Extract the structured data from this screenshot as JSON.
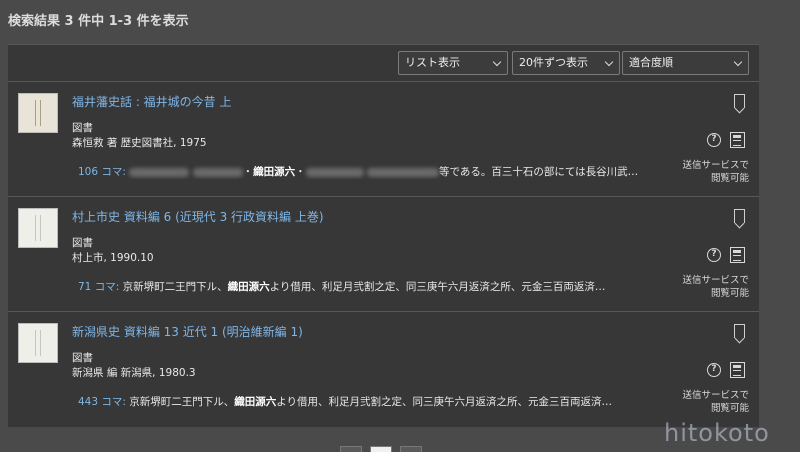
{
  "summary": "検索結果 3 件中 1-3 件を表示",
  "toolbar": {
    "view": "リスト表示",
    "per_page": "20件ずつ表示",
    "sort": "適合度順"
  },
  "results": [
    {
      "title": "福井藩史話 : 福井城の今昔 上",
      "type": "図書",
      "meta": "森恒救 著 歴史図書社, 1975",
      "koma": "106 コマ:",
      "snippet_highlight": "織田源六",
      "snippet_after": "等である。百三十石の部にては長谷川武…",
      "service": "送信サービスで閲覧可能"
    },
    {
      "title": "村上市史 資料編 6 (近現代 3 行政資料編 上巻)",
      "type": "図書",
      "meta": "村上市, 1990.10",
      "koma": "71 コマ:",
      "snippet_before": "京新堺町二王門下ル、",
      "snippet_highlight": "織田源六",
      "snippet_after": "より借用、利足月弐割之定、同三庚午六月返済之所、元金三百両返済…",
      "service": "送信サービスで閲覧可能"
    },
    {
      "title": "新潟県史 資料編 13 近代 1 (明治維新編 1)",
      "type": "図書",
      "meta": "新潟県 編 新潟県, 1980.3",
      "koma": "443 コマ:",
      "snippet_before": "京新堺町二王門下ル、",
      "snippet_highlight": "織田源六",
      "snippet_after": "より借用、利足月弐割之定、同三庚午六月返済之所、元金三百両返済…",
      "service": "送信サービスで閲覧可能"
    }
  ],
  "watermark": "hitokoto",
  "colors": {
    "background": "#4a4a4a",
    "panel": "#373737",
    "link": "#7fb6e6"
  }
}
